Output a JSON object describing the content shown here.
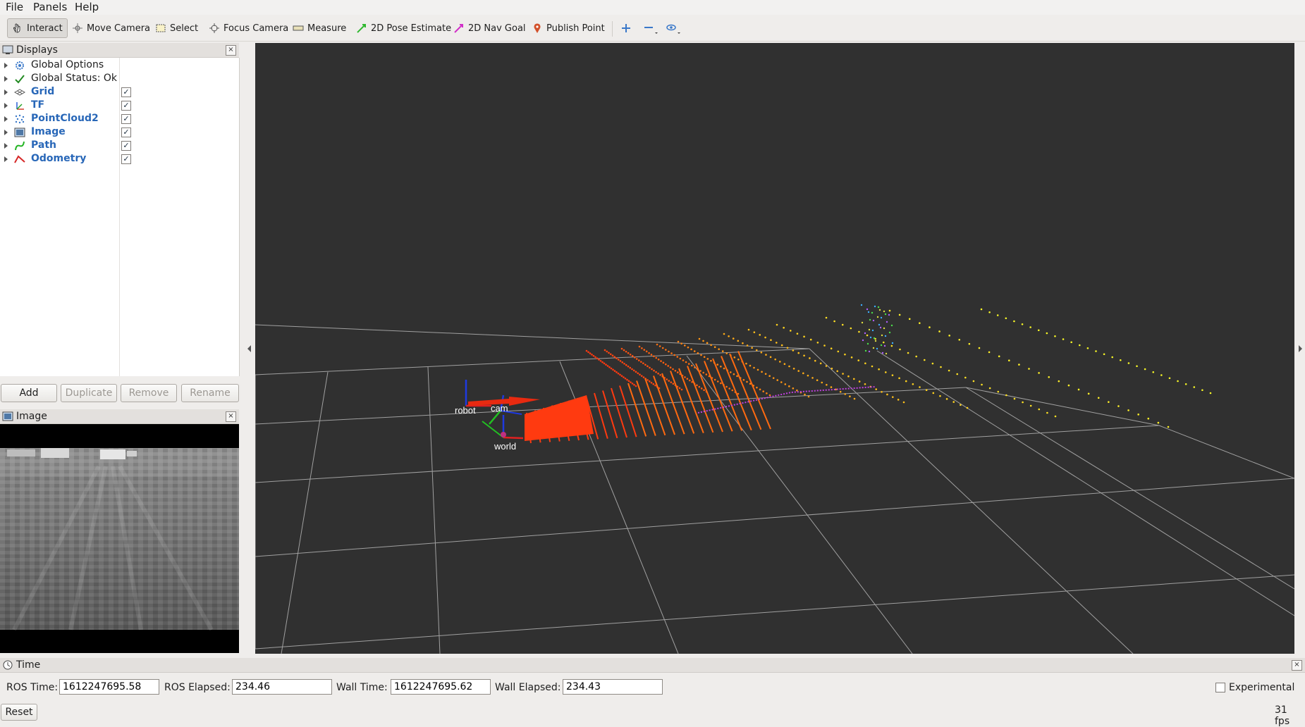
{
  "menubar": {
    "items": [
      "File",
      "Panels",
      "Help"
    ]
  },
  "toolbar": {
    "tools": [
      "Interact",
      "Move Camera",
      "Select",
      "Focus Camera",
      "Measure",
      "2D Pose Estimate",
      "2D Nav Goal",
      "Publish Point"
    ],
    "active": "Interact",
    "extra_icons": [
      "plus-icon",
      "minus-icon",
      "eye-icon"
    ]
  },
  "displays": {
    "title": "Displays",
    "items": [
      {
        "label": "Global Options",
        "icon": "gear-icon",
        "checked": null,
        "color": "#1e1e1e"
      },
      {
        "label": "Global Status: Ok",
        "icon": "checkmark-icon",
        "checked": null,
        "color": "#1e1e1e"
      },
      {
        "label": "Grid",
        "icon": "grid-icon",
        "checked": true,
        "color": "#2867b8"
      },
      {
        "label": "TF",
        "icon": "tf-icon",
        "checked": true,
        "color": "#2867b8"
      },
      {
        "label": "PointCloud2",
        "icon": "pointcloud-icon",
        "checked": true,
        "color": "#2867b8"
      },
      {
        "label": "Image",
        "icon": "image-icon",
        "checked": true,
        "color": "#2867b8"
      },
      {
        "label": "Path",
        "icon": "path-icon",
        "checked": true,
        "color": "#2867b8"
      },
      {
        "label": "Odometry",
        "icon": "odometry-icon",
        "checked": true,
        "color": "#2867b8"
      }
    ],
    "buttons": {
      "add": "Add",
      "duplicate": "Duplicate",
      "remove": "Remove",
      "rename": "Rename"
    }
  },
  "image_panel": {
    "title": "Image"
  },
  "view3d": {
    "frames": [
      "robot",
      "cam",
      "world"
    ],
    "background": "#303030"
  },
  "time": {
    "title": "Time",
    "ros_time_label": "ROS Time:",
    "ros_time": "1612247695.58",
    "ros_elapsed_label": "ROS Elapsed:",
    "ros_elapsed": "234.46",
    "wall_time_label": "Wall Time:",
    "wall_time": "1612247695.62",
    "wall_elapsed_label": "Wall Elapsed:",
    "wall_elapsed": "234.43",
    "experimental_label": "Experimental",
    "reset_label": "Reset",
    "fps": "31 fps"
  }
}
